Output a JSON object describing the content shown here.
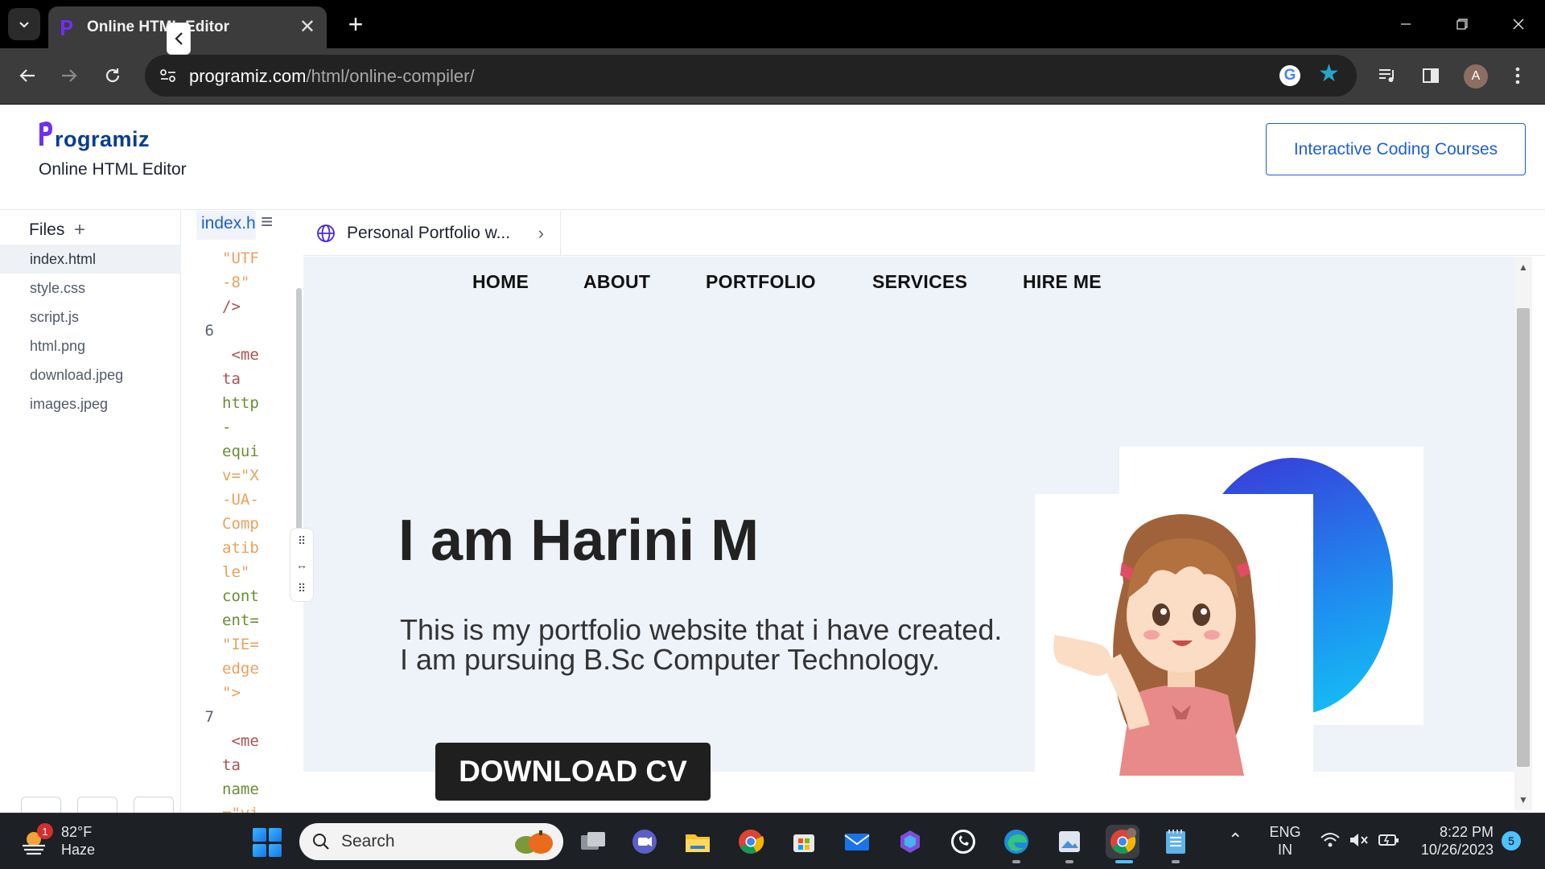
{
  "browser": {
    "tab_title": "Online HTML Editor",
    "url_domain": "programiz.com",
    "url_path": "/html/online-compiler/",
    "profile_initial": "A"
  },
  "header": {
    "logo_text": "rogramiz",
    "editor_title": "Online HTML Editor",
    "courses_button": "Interactive Coding Courses"
  },
  "files": {
    "title": "Files",
    "add_symbol": "+",
    "items": [
      "index.html",
      "style.css",
      "script.js",
      "html.png",
      "download.jpeg",
      "images.jpeg"
    ]
  },
  "code": {
    "tab_label": "index.html",
    "lines": [
      {
        "num": "",
        "text": "\"UTF",
        "color": "#e8a25c"
      },
      {
        "num": "",
        "text": "-8\"",
        "color": "#e8a25c"
      },
      {
        "num": "",
        "text": "/>",
        "color": "#b05050"
      },
      {
        "num": "6",
        "text": "",
        "color": "#333"
      },
      {
        "num": "",
        "text": " <me",
        "color": "#b05050"
      },
      {
        "num": "",
        "text": "ta",
        "color": "#b05050"
      },
      {
        "num": "",
        "text": "http",
        "color": "#6a8e35"
      },
      {
        "num": "",
        "text": "-",
        "color": "#6a8e35"
      },
      {
        "num": "",
        "text": "equi",
        "color": "#6a8e35"
      },
      {
        "num": "",
        "text": "v=\"X",
        "color": "#e8a25c"
      },
      {
        "num": "",
        "text": "-UA-",
        "color": "#e8a25c"
      },
      {
        "num": "",
        "text": "Comp",
        "color": "#e8a25c"
      },
      {
        "num": "",
        "text": "atib",
        "color": "#e8a25c"
      },
      {
        "num": "",
        "text": "le\"",
        "color": "#e8a25c"
      },
      {
        "num": "",
        "text": "cont",
        "color": "#6a8e35"
      },
      {
        "num": "",
        "text": "ent=",
        "color": "#6a8e35"
      },
      {
        "num": "",
        "text": "\"IE=",
        "color": "#e8a25c"
      },
      {
        "num": "",
        "text": "edge",
        "color": "#e8a25c"
      },
      {
        "num": "",
        "text": "\">",
        "color": "#e8a25c"
      },
      {
        "num": "7",
        "text": "",
        "color": "#333"
      },
      {
        "num": "",
        "text": " <me",
        "color": "#b05050"
      },
      {
        "num": "",
        "text": "ta",
        "color": "#b05050"
      },
      {
        "num": "",
        "text": "name",
        "color": "#6a8e35"
      },
      {
        "num": "",
        "text": "=\"vi",
        "color": "#e8a25c"
      }
    ]
  },
  "preview": {
    "tab_title": "Personal Portfolio w...",
    "nav": [
      "HOME",
      "ABOUT",
      "PORTFOLIO",
      "SERVICES",
      "HIRE ME"
    ],
    "heading": "I am Harini M",
    "desc_line1": "This is my portfolio website that i have created.",
    "desc_line2": "I am pursuing B.Sc Computer Technology.",
    "cv_button": "DOWNLOAD CV"
  },
  "taskbar": {
    "temperature": "82°F",
    "weather": "Haze",
    "weather_badge": "1",
    "search_placeholder": "Search",
    "lang": "ENG",
    "region": "IN",
    "time": "8:22 PM",
    "date": "10/26/2023",
    "notifications": "5"
  },
  "colors": {
    "accent": "#1c5fd6",
    "hero_bg": "#eef2f9",
    "cv_button_bg": "#1f1f1f"
  }
}
